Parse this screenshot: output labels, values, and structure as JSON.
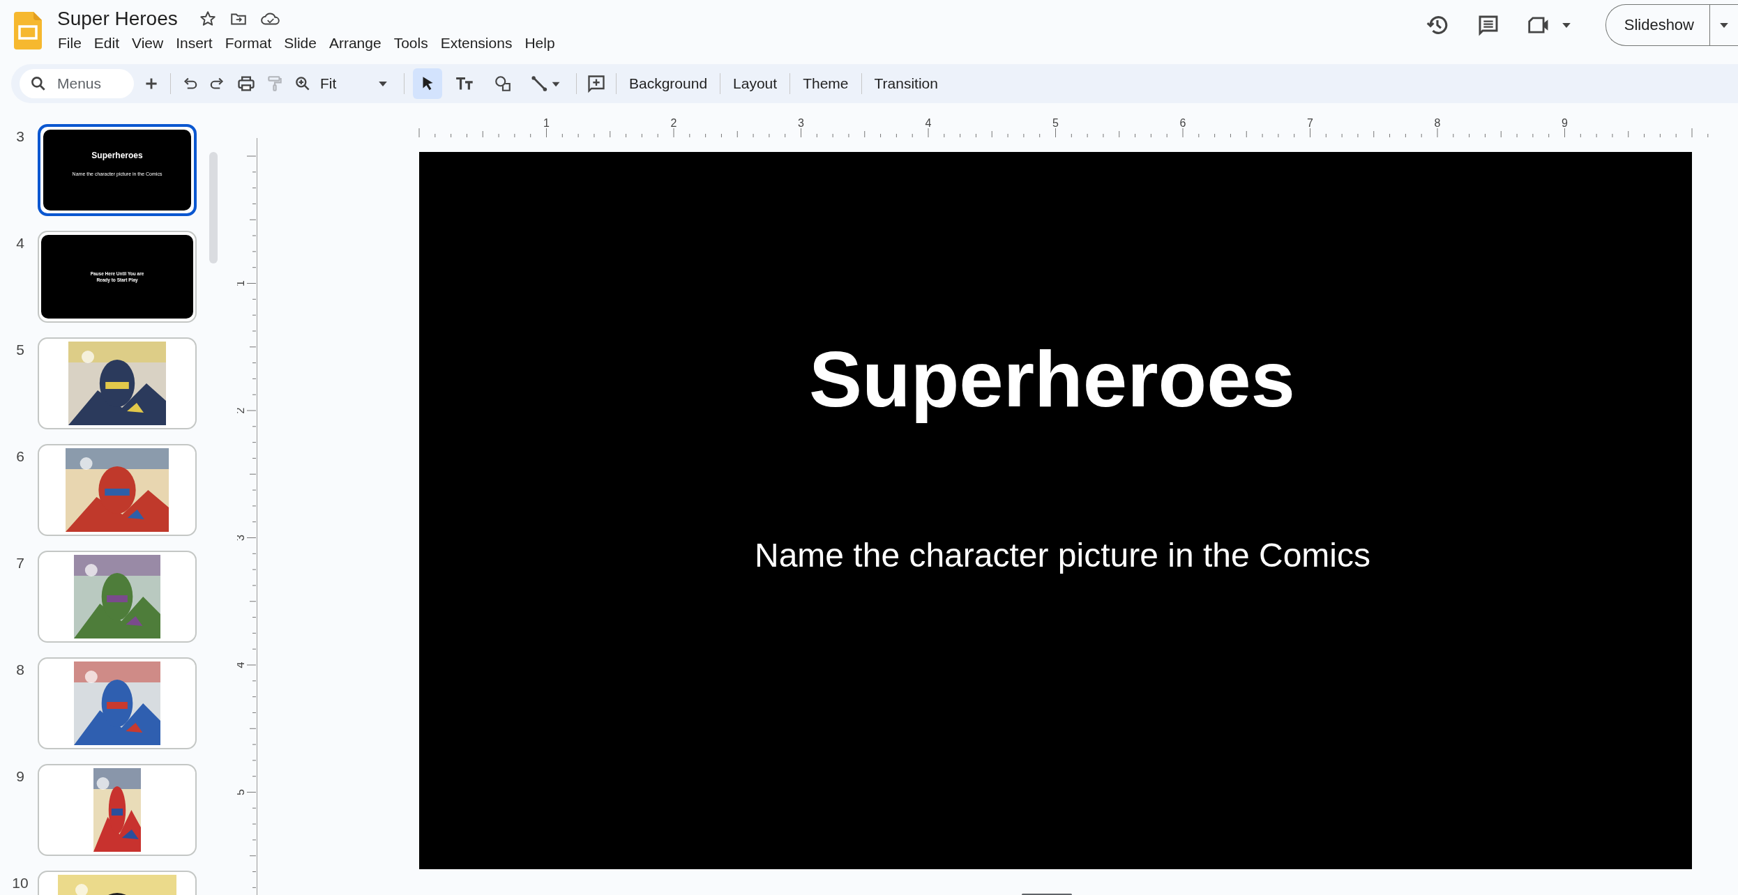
{
  "app": {
    "title": "Super Heroes"
  },
  "menu": [
    "File",
    "Edit",
    "View",
    "Insert",
    "Format",
    "Slide",
    "Arrange",
    "Tools",
    "Extensions",
    "Help"
  ],
  "header": {
    "slideshow": "Slideshow"
  },
  "toolbar": {
    "search": {
      "placeholder": "Menus"
    },
    "zoom": "Fit",
    "paint_format": {
      "disabled": true
    },
    "tools": [
      {
        "kind": "select",
        "selected": true
      },
      {
        "kind": "text",
        "selected": false
      },
      {
        "kind": "shape",
        "selected": false
      },
      {
        "kind": "line",
        "selected": false
      }
    ],
    "actions": [
      "Background",
      "Layout",
      "Theme",
      "Transition"
    ]
  },
  "filmstrip": [
    {
      "number": "3",
      "selected": true,
      "kind": "title",
      "title": "Superheroes",
      "subtitle": "Name the character picture in the Comics"
    },
    {
      "number": "4",
      "selected": false,
      "kind": "text",
      "text": "Pause Here Until You are Ready to Start Play"
    },
    {
      "number": "5",
      "selected": false,
      "kind": "picture"
    },
    {
      "number": "6",
      "selected": false,
      "kind": "picture"
    },
    {
      "number": "7",
      "selected": false,
      "kind": "picture"
    },
    {
      "number": "8",
      "selected": false,
      "kind": "picture"
    },
    {
      "number": "9",
      "selected": false,
      "kind": "picture"
    },
    {
      "number": "10",
      "selected": false,
      "kind": "picture"
    }
  ],
  "ruler": {
    "horizontal": [
      "1",
      "2",
      "3",
      "4",
      "5",
      "6",
      "7",
      "8",
      "9"
    ],
    "vertical": [
      "1",
      "2",
      "3",
      "4",
      "5"
    ]
  },
  "slide": {
    "title": "Superheroes",
    "subtitle": "Name the character picture in the Comics"
  }
}
